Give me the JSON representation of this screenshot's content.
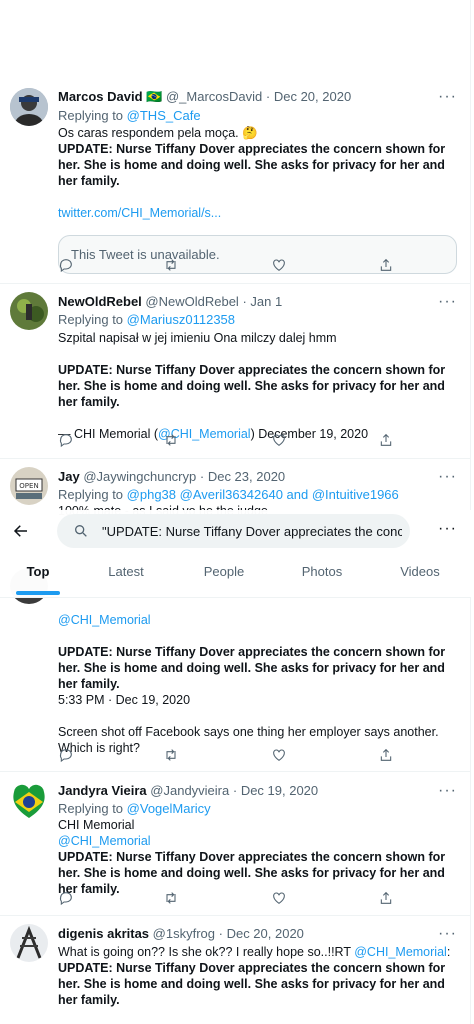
{
  "tweets": [
    {
      "name": "Marcos David",
      "flag": "🇧🇷",
      "handle": "@_MarcosDavid",
      "date": "Dec 20, 2020",
      "replying_label": "Replying to",
      "replying_to": "@THS_Cafe",
      "line1": "Os caras respondem pela moça. 🤔",
      "update": "UPDATE: Nurse Tiffany Dover appreciates the concern shown for her. She is home and doing well.  She asks for privacy for her and her family.",
      "link": "twitter.com/CHI_Memorial/s...",
      "quoted": "This Tweet is unavailable."
    },
    {
      "name": "NewOldRebel",
      "handle": "@NewOldRebel",
      "date": "Jan 1",
      "replying_label": "Replying to",
      "replying_to": "@Mariusz0112358",
      "line1": "Szpital napisał w jej imieniu Ona milczy dalej hmm",
      "update": "UPDATE: Nurse Tiffany Dover appreciates the concern shown for her. She is home and doing well. She asks for privacy for her and her family.",
      "sig_pre": "— CHI Memorial (",
      "sig_handle": "@CHI_Memorial",
      "sig_post": ") December 19, 2020"
    },
    {
      "name": "Jay",
      "handle": "@Jaywingchuncryp",
      "date": "Dec 23, 2020",
      "replying_label": "Replying to",
      "replying_to": "@phg38 @Averil36342640 and @Intuitive1966",
      "line1": "100% mate - as I said yo he the judge"
    },
    {
      "handle_line": "@CHI_Memorial",
      "update": "UPDATE: Nurse Tiffany Dover appreciates the concern shown for her. She is home and doing well.  She asks for privacy for her and her family.",
      "time": "5:33 PM · Dec 19, 2020",
      "text": "Screen shot off Facebook says one thing her employer says another. Which is right?"
    },
    {
      "name": "Jandyra Vieira",
      "handle": "@Jandyvieira",
      "date": "Dec 19, 2020",
      "replying_label": "Replying to",
      "replying_to": "@VogelMaricy",
      "line1": "CHI Memorial",
      "line2": "@CHI_Memorial",
      "update": "UPDATE: Nurse Tiffany Dover appreciates the concern shown for her. She is home and doing well.  She asks for privacy for her and her family."
    },
    {
      "name": "digenis akritas",
      "handle": "@1skyfrog",
      "date": "Dec 20, 2020",
      "line1_pre": "What is going on?? Is she ok?? I really hope so..!!RT ",
      "line1_handle": "@CHI_Memorial",
      "line1_post": ":",
      "update": "UPDATE: Nurse Tiffany Dover appreciates the concern shown for her. She is home and doing well.  She asks for privacy for her and her family."
    }
  ],
  "search": {
    "query": "\"UPDATE: Nurse Tiffany Dover appreciates the concern shown for her. She is home\""
  },
  "tabs": [
    "Top",
    "Latest",
    "People",
    "Photos",
    "Videos"
  ],
  "colors": {
    "accent": "#1d9bf0",
    "muted": "#536471"
  },
  "icons": [
    "more-icon",
    "reply-icon",
    "retweet-icon",
    "like-icon",
    "share-icon",
    "back-arrow-icon",
    "search-icon"
  ]
}
